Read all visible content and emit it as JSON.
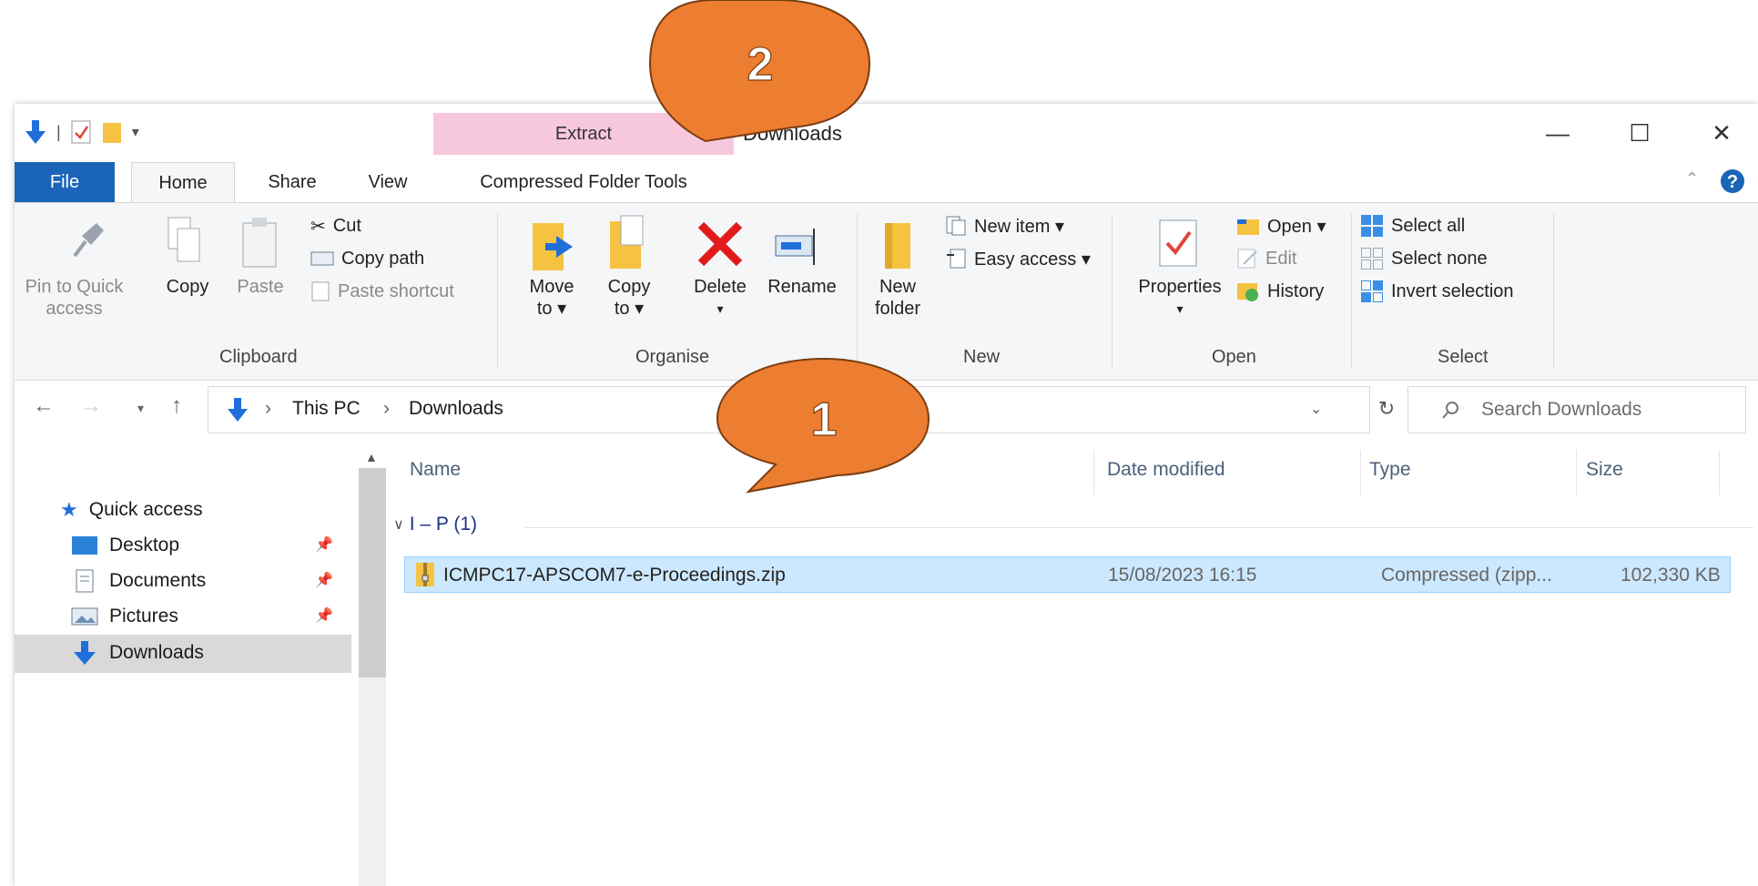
{
  "window": {
    "title": "Downloads",
    "controls": {
      "minimize": "—",
      "maximize": "☐",
      "close": "✕"
    }
  },
  "quick_access_toolbar": {
    "divider": "|"
  },
  "contextual_tab": {
    "label": "Extract"
  },
  "tabs": {
    "file": "File",
    "home": "Home",
    "share": "Share",
    "view": "View",
    "compressed": "Compressed Folder Tools"
  },
  "ribbon": {
    "clipboard": {
      "group_label": "Clipboard",
      "pin_line1": "Pin to Quick",
      "pin_line2": "access",
      "copy": "Copy",
      "paste": "Paste",
      "cut": "Cut",
      "copy_path": "Copy path",
      "paste_shortcut": "Paste shortcut"
    },
    "organise": {
      "group_label": "Organise",
      "move_line1": "Move",
      "move_line2": "to ▾",
      "copy_line1": "Copy",
      "copy_line2": "to ▾",
      "delete": "Delete",
      "delete_arrow": "▾",
      "rename": "Rename"
    },
    "new": {
      "group_label": "New",
      "new_folder_line1": "New",
      "new_folder_line2": "folder",
      "new_item": "New item ▾",
      "easy_access": "Easy access ▾"
    },
    "open": {
      "group_label": "Open",
      "properties": "Properties",
      "properties_arrow": "▾",
      "open": "Open ▾",
      "edit": "Edit",
      "history": "History"
    },
    "select": {
      "group_label": "Select",
      "select_all": "Select all",
      "select_none": "Select none",
      "invert_selection": "Invert selection"
    }
  },
  "address_bar": {
    "separator": "›",
    "segment1": "This PC",
    "segment2": "Downloads",
    "search_placeholder": "Search Downloads"
  },
  "nav_pane": {
    "items": [
      {
        "label": "Quick access"
      },
      {
        "label": "Desktop"
      },
      {
        "label": "Documents"
      },
      {
        "label": "Pictures"
      },
      {
        "label": "Downloads"
      }
    ]
  },
  "file_list": {
    "columns": {
      "name": "Name",
      "date": "Date modified",
      "type": "Type",
      "size": "Size"
    },
    "group_label": "I – P (1)",
    "rows": [
      {
        "name": "ICMPC17-APSCOM7-e-Proceedings.zip",
        "date": "15/08/2023 16:15",
        "type": "Compressed (zipp...",
        "size": "102,330 KB"
      }
    ]
  },
  "callouts": {
    "first": "1",
    "second": "2"
  },
  "colors": {
    "file_tab": "#1a65b8",
    "contextual": "#f7c7dd",
    "callout": "#ed7d31",
    "selection": "#cce8ff"
  }
}
